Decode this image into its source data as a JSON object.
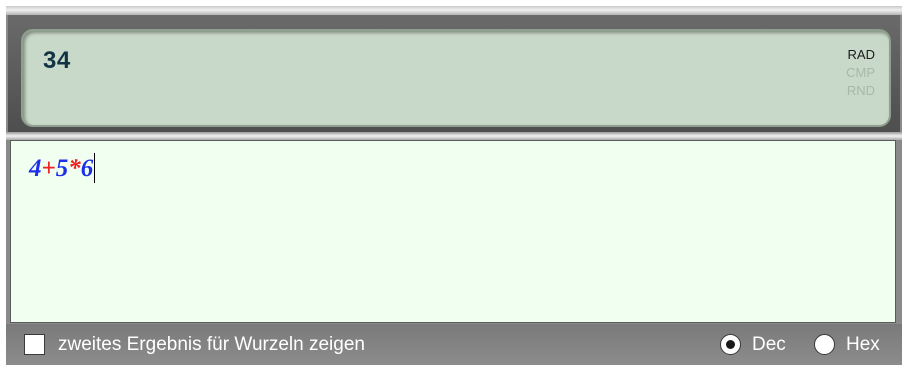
{
  "display": {
    "result": "34",
    "flags": [
      {
        "label": "RAD",
        "active": true
      },
      {
        "label": "CMP",
        "active": false
      },
      {
        "label": "RND",
        "active": false
      }
    ]
  },
  "editor": {
    "tokens": [
      {
        "text": "4",
        "color": "#1f2ee8"
      },
      {
        "text": "+",
        "color": "#ee2222"
      },
      {
        "text": "5",
        "color": "#1f2ee8"
      },
      {
        "text": "*",
        "color": "#ee2222"
      },
      {
        "text": "6",
        "color": "#1f2ee8"
      }
    ]
  },
  "options": {
    "second_root_result_label": "zweites Ergebnis für Wurzeln zeigen",
    "second_root_result_checked": false,
    "number_base": {
      "options": [
        {
          "label": "Dec",
          "selected": true
        },
        {
          "label": "Hex",
          "selected": false
        }
      ]
    }
  }
}
